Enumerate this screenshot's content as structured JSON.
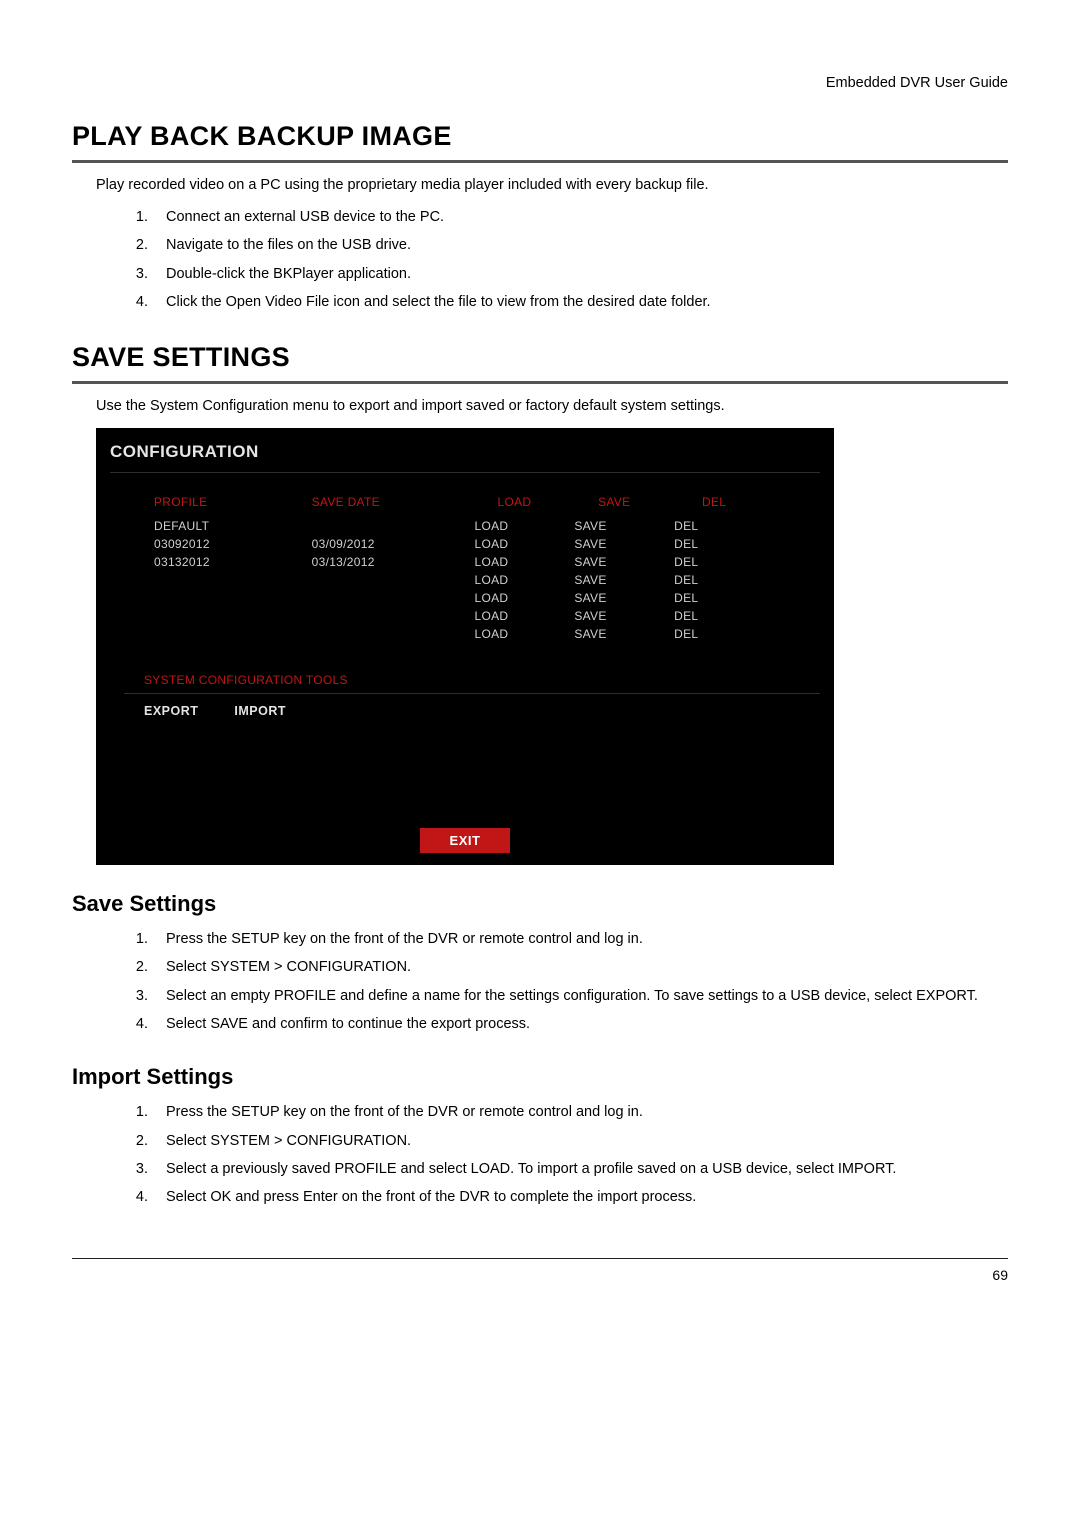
{
  "header": {
    "doc_title": "Embedded DVR User Guide"
  },
  "section1": {
    "heading": "PLAY BACK BACKUP IMAGE",
    "intro": "Play recorded video on a PC using the proprietary media player included with every backup file.",
    "steps": [
      "Connect an external USB device to the PC.",
      "Navigate to the files on the USB drive.",
      "Double-click the BKPlayer application.",
      "Click the Open Video File icon and select the file to view from the desired date folder."
    ]
  },
  "section2": {
    "heading": "SAVE SETTINGS",
    "intro": "Use the System Configuration menu to export and import saved or factory default system settings."
  },
  "config": {
    "title": "CONFIGURATION",
    "columns": {
      "profile": "PROFILE",
      "save_date": "SAVE DATE",
      "load": "LOAD",
      "save": "SAVE",
      "del": "DEL"
    },
    "rows": [
      {
        "profile": "DEFAULT",
        "date": "",
        "load": "LOAD",
        "save": "SAVE",
        "del": "DEL"
      },
      {
        "profile": "03092012",
        "date": "03/09/2012",
        "load": "LOAD",
        "save": "SAVE",
        "del": "DEL"
      },
      {
        "profile": "03132012",
        "date": "03/13/2012",
        "load": "LOAD",
        "save": "SAVE",
        "del": "DEL"
      },
      {
        "profile": "",
        "date": "",
        "load": "LOAD",
        "save": "SAVE",
        "del": "DEL"
      },
      {
        "profile": "",
        "date": "",
        "load": "LOAD",
        "save": "SAVE",
        "del": "DEL"
      },
      {
        "profile": "",
        "date": "",
        "load": "LOAD",
        "save": "SAVE",
        "del": "DEL"
      },
      {
        "profile": "",
        "date": "",
        "load": "LOAD",
        "save": "SAVE",
        "del": "DEL"
      }
    ],
    "tools_label": "SYSTEM CONFIGURATION TOOLS",
    "export": "EXPORT",
    "import": "IMPORT",
    "exit": "EXIT"
  },
  "section3": {
    "heading": "Save Settings",
    "steps": [
      "Press the SETUP key on the front of the DVR or remote control and log in.",
      "Select SYSTEM > CONFIGURATION.",
      "Select an empty PROFILE and define a name for the settings configuration. To save settings to a USB device, select EXPORT.",
      "Select SAVE and confirm to continue the export process."
    ]
  },
  "section4": {
    "heading": "Import Settings",
    "steps": [
      "Press the SETUP key on the front of the DVR or remote control and log in.",
      "Select SYSTEM > CONFIGURATION.",
      "Select a previously saved PROFILE and select LOAD. To import a profile saved on a USB device, select IMPORT.",
      "Select OK and press Enter on the front of the DVR to complete the import process."
    ]
  },
  "footer": {
    "page": "69"
  }
}
